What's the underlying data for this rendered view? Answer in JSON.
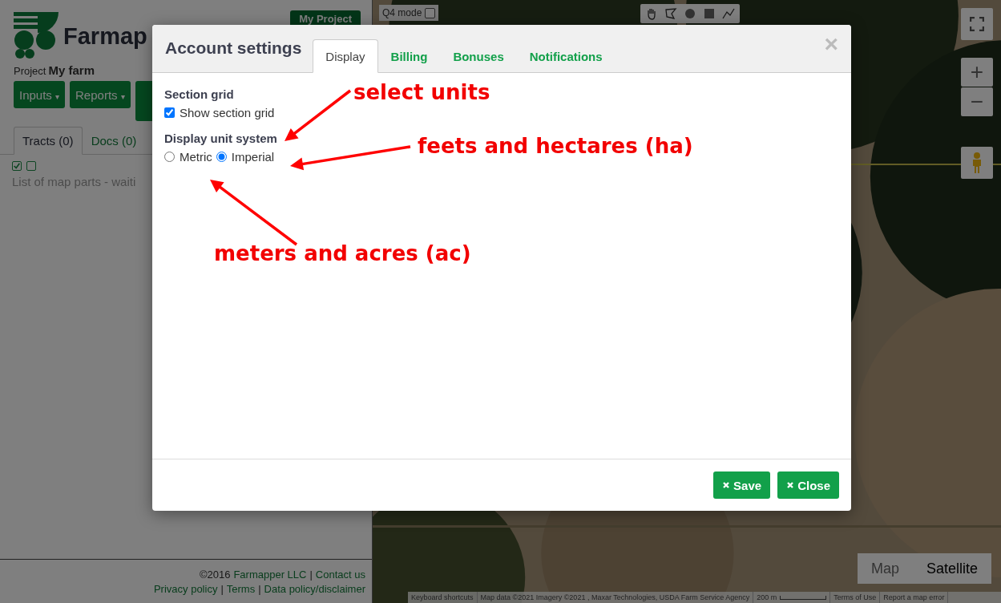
{
  "sidebar": {
    "brand": "Farmap",
    "caret": "▾",
    "project_label": "Project",
    "project_name": "My farm",
    "my_project_button": "My Project",
    "menu_buttons": [
      {
        "label": "Inputs"
      },
      {
        "label": "Reports"
      }
    ],
    "tabs": [
      {
        "label": "Tracts (0)",
        "selected": true
      },
      {
        "label": "Docs  (0)",
        "selected": false
      }
    ],
    "list_checkboxes": [
      {
        "checked": true
      },
      {
        "checked": false
      }
    ],
    "list_status": "List of map parts - waiti",
    "footer": {
      "copyright": "©2016",
      "company_link": "Farmapper LLC",
      "separator": "|",
      "contact_link": "Contact us",
      "links": [
        "Privacy policy",
        "Terms",
        "Data policy/disclaimer"
      ]
    }
  },
  "map": {
    "q4_mode": {
      "label": "Q4 mode",
      "checked": false
    },
    "zoom_buttons": [
      "+",
      "−"
    ],
    "map_types": [
      {
        "label": "Map",
        "selected": false
      },
      {
        "label": "Satellite",
        "selected": true
      }
    ],
    "attribution": [
      "Keyboard shortcuts",
      "Map data ©2021 Imagery ©2021 , Maxar Technologies, USDA Farm Service Agency",
      "200 m",
      "Terms of Use",
      "Report a map error"
    ]
  },
  "modal": {
    "title": "Account settings",
    "close_glyph": "×",
    "tabs": [
      {
        "label": "Display",
        "selected": true
      },
      {
        "label": "Billing",
        "selected": false
      },
      {
        "label": "Bonuses",
        "selected": false
      },
      {
        "label": "Notifications",
        "selected": false
      }
    ],
    "section_grid": {
      "heading": "Section grid",
      "checkbox": {
        "label": "Show section grid",
        "checked": true
      }
    },
    "unit_system": {
      "heading": "Display unit system",
      "options": [
        {
          "label": "Metric",
          "selected": false
        },
        {
          "label": "Imperial",
          "selected": true
        }
      ]
    },
    "buttons": [
      {
        "label": "Save"
      },
      {
        "label": "Close"
      }
    ]
  },
  "annotations": [
    {
      "text": "select units"
    },
    {
      "text": "feets and hectares (ha)"
    },
    {
      "text": "meters and acres (ac)"
    }
  ]
}
